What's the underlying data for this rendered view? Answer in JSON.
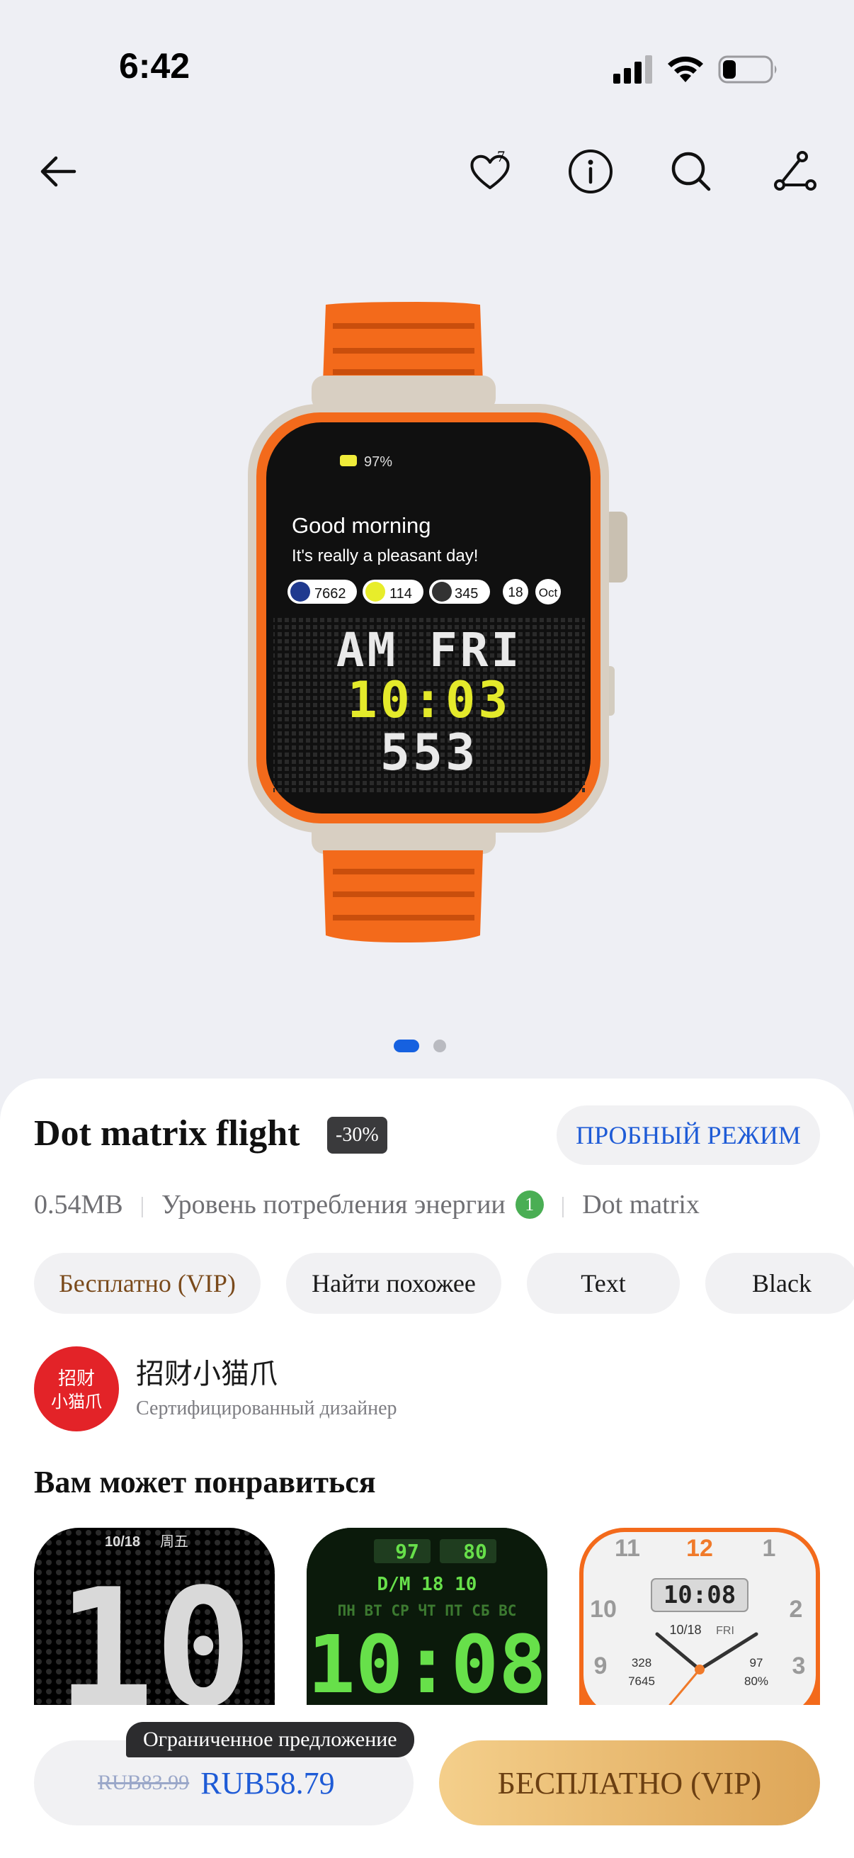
{
  "status_bar": {
    "time": "6:42"
  },
  "nav": {
    "favorites_count": "7",
    "icons": [
      "back-arrow-icon",
      "heart-icon",
      "info-icon",
      "search-icon",
      "share-icon"
    ]
  },
  "hero": {
    "screen": {
      "battery": "97%",
      "greeting": "Good morning",
      "subtitle": "It's really a pleasant day!",
      "steps": "7662",
      "heart": "114",
      "calories": "345",
      "day": "18",
      "month": "Oct",
      "line1": "AM FRI",
      "line2": "10:03",
      "line3": "553"
    },
    "carousel": {
      "count": 2,
      "active": 0
    }
  },
  "product": {
    "title": "Dot matrix flight",
    "discount": "-30%",
    "trial_label": "ПРОБНЫЙ РЕЖИМ",
    "size": "0.54MB",
    "energy_label": "Уровень потребления энергии",
    "energy_level": "1",
    "style": "Dot matrix",
    "chips": [
      "Бесплатно (VIP)",
      "Найти похожее",
      "Text",
      "Black"
    ]
  },
  "designer": {
    "avatar_text_1": "招财",
    "avatar_text_2": "小猫爪",
    "name": "招财小猫爪",
    "subtitle": "Сертифицированный дизайнер"
  },
  "recommendations": {
    "title": "Вам может понравиться",
    "items": [
      {
        "date": "10/18",
        "weekday": "周五",
        "digits": "10"
      },
      {
        "val1": "97",
        "val2": "80",
        "date": "D/M 18 10",
        "days": "ПН ВТ СР ЧТ ПТ СБ ВС",
        "time": "10:08"
      },
      {
        "n11": "11",
        "n12": "12",
        "n1": "1",
        "n10": "10",
        "n2": "2",
        "n9": "9",
        "n3": "3",
        "time": "10:08",
        "date": "10/18",
        "weekday": "FRI",
        "s1": "328",
        "s2": "7645",
        "s3": "97",
        "s4": "80%"
      }
    ]
  },
  "purchase": {
    "offer_label": "Ограниченное предложение",
    "old_price": "RUB83.99",
    "new_price": "RUB58.79",
    "vip_button": "БЕСПЛАТНО (VIP)"
  },
  "colors": {
    "accent": "#1e5bd6",
    "band": "#f36a1b",
    "vip_gradient_start": "#f4cf8b",
    "vip_gradient_end": "#dea658"
  }
}
